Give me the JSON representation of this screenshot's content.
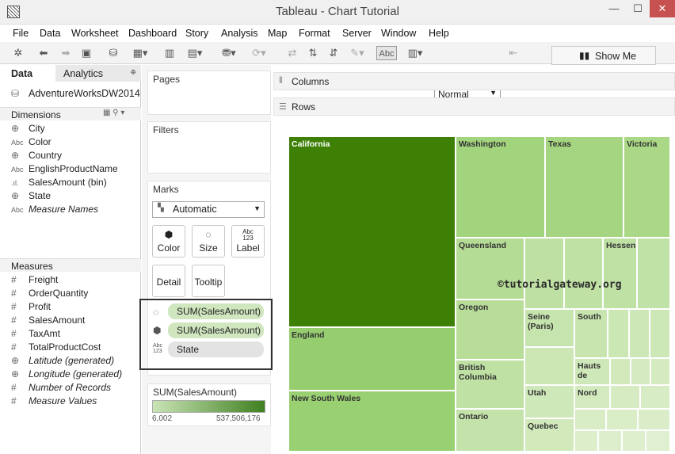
{
  "window": {
    "title": "Tableau - Chart Tutorial",
    "minimize": "—",
    "maximize": "☐",
    "close": "✕"
  },
  "menu": [
    "File",
    "Data",
    "Worksheet",
    "Dashboard",
    "Story",
    "Analysis",
    "Map",
    "Format",
    "Server",
    "Window",
    "Help"
  ],
  "toolbar": {
    "fit_select": "Normal",
    "abc_label": "Abc",
    "show_me": "Show Me"
  },
  "data_pane": {
    "tab_data": "Data",
    "tab_analytics": "Analytics",
    "datasource": "AdventureWorksDW2014",
    "dimensions_header": "Dimensions",
    "dimensions": [
      {
        "icon": "globe-icon",
        "name": "City"
      },
      {
        "icon": "abc-icon",
        "name": "Color"
      },
      {
        "icon": "globe-icon",
        "name": "Country"
      },
      {
        "icon": "abc-icon",
        "name": "EnglishProductName"
      },
      {
        "icon": "bin-icon",
        "name": "SalesAmount (bin)"
      },
      {
        "icon": "globe-icon",
        "name": "State"
      },
      {
        "icon": "abc-icon",
        "name": "Measure Names"
      }
    ],
    "measures_header": "Measures",
    "measures": [
      {
        "icon": "hash-icon",
        "name": "Freight"
      },
      {
        "icon": "hash-icon",
        "name": "OrderQuantity"
      },
      {
        "icon": "hash-icon",
        "name": "Profit"
      },
      {
        "icon": "hash-icon",
        "name": "SalesAmount"
      },
      {
        "icon": "hash-icon",
        "name": "TaxAmt"
      },
      {
        "icon": "hash-icon",
        "name": "TotalProductCost"
      },
      {
        "icon": "globe-icon",
        "name": "Latitude (generated)"
      },
      {
        "icon": "globe-icon",
        "name": "Longitude (generated)"
      },
      {
        "icon": "hash-icon",
        "name": "Number of Records"
      },
      {
        "icon": "hash-icon",
        "name": "Measure Values"
      }
    ]
  },
  "cards": {
    "pages": "Pages",
    "filters": "Filters",
    "marks": "Marks",
    "mark_type": "Automatic",
    "buttons": {
      "color": "Color",
      "size": "Size",
      "label": "Label",
      "detail": "Detail",
      "tooltip": "Tooltip"
    },
    "pills": [
      "SUM(SalesAmount)",
      "SUM(SalesAmount)",
      "State"
    ],
    "legend_title": "SUM(SalesAmount)",
    "legend_min": "6,002",
    "legend_max": "537,506,176"
  },
  "shelves": {
    "columns": "Columns",
    "rows": "Rows"
  },
  "view": {
    "watermark": "©tutorialgateway.org",
    "colors": {
      "darkest": "#3d8005",
      "mid": "#9fd27a",
      "light": "#c3e3a8",
      "lighter": "#d3ebc0"
    },
    "tiles": [
      "California",
      "Washington",
      "Texas",
      "Victoria",
      "Queensland",
      "Hessen",
      "Oregon",
      "Seine (Paris)",
      "South",
      "England",
      "British Columbia",
      "Hauts de",
      "Utah",
      "Nord",
      "New South Wales",
      "Ontario",
      "Quebec"
    ]
  }
}
